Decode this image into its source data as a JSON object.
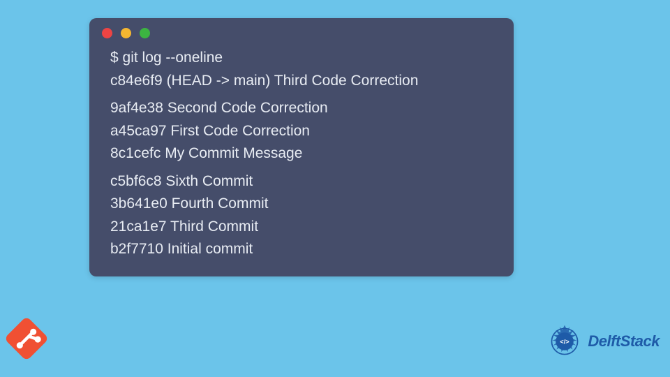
{
  "terminal": {
    "command": "$ git log --oneline",
    "blocks": [
      [
        "c84e6f9 (HEAD -> main) Third Code Correction"
      ],
      [
        "9af4e38 Second Code Correction",
        "a45ca97 First Code Correction",
        "8c1cefc My Commit Message"
      ],
      [
        "c5bf6c8 Sixth Commit",
        "3b641e0 Fourth Commit",
        "21ca1e7 Third Commit",
        "b2f7710 Initial commit"
      ]
    ]
  },
  "branding": {
    "delftstack": "DelftStack"
  },
  "colors": {
    "background": "#6bc4ea",
    "terminal": "#454d6a",
    "text": "#e8ecf3",
    "git": "#f05033",
    "delft": "#1e5ba8"
  }
}
